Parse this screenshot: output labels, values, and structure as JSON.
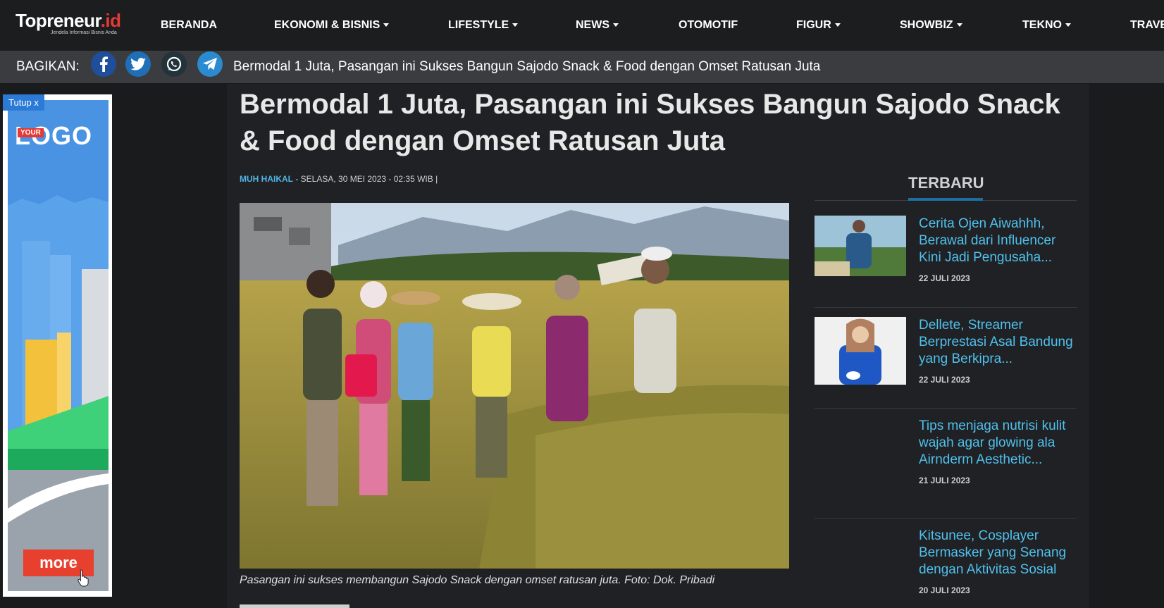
{
  "logo": {
    "name": "Topreneur",
    "suffix": ".id",
    "tagline": "Jendela Informasi Bisnis Anda"
  },
  "nav": [
    {
      "label": "BERANDA",
      "caret": false
    },
    {
      "label": "EKONOMI & BISNIS",
      "caret": true
    },
    {
      "label": "LIFESTYLE",
      "caret": true
    },
    {
      "label": "NEWS",
      "caret": true
    },
    {
      "label": "OTOMOTIF",
      "caret": false
    },
    {
      "label": "FIGUR",
      "caret": true
    },
    {
      "label": "SHOWBIZ",
      "caret": true
    },
    {
      "label": "TEKNO",
      "caret": true
    },
    {
      "label": "TRAVE",
      "caret": false
    }
  ],
  "share": {
    "label": "BAGIKAN:",
    "icons": [
      "facebook-icon",
      "twitter-icon",
      "whatsapp-icon",
      "telegram-icon"
    ],
    "title": "Bermodal 1 Juta, Pasangan ini Sukses Bangun Sajodo Snack & Food dengan Omset Ratusan Juta"
  },
  "ad": {
    "close_label": "Tutup x",
    "logo_badge": "YOUR",
    "logo_text": "LOGO",
    "more_label": "more"
  },
  "article": {
    "title": "Bermodal 1 Juta, Pasangan ini Sukses Bangun Sajodo Snack & Food dengan Omset Ratusan Juta",
    "author": "MUH HAIKAL",
    "meta_rest": " - SELASA, 30 MEI 2023 - 02:35 WIB |",
    "caption": "Pasangan ini sukses membangun Sajodo Snack dengan omset ratusan juta. Foto: Dok. Pribadi"
  },
  "sidebar": {
    "heading": "TERBARU",
    "items": [
      {
        "title": "Cerita Ojen Aiwahhh, Berawal dari Influencer Kini Jadi Pengusaha...",
        "date": "22 JULI 2023",
        "thumb": true
      },
      {
        "title": "Dellete, Streamer Berprestasi Asal Bandung yang Berkipra...",
        "date": "22 JULI 2023",
        "thumb": true
      },
      {
        "title": "Tips menjaga nutrisi kulit wajah agar glowing ala Airnderm Aesthetic...",
        "date": "21 JULI 2023",
        "thumb": false
      },
      {
        "title": "Kitsunee, Cosplayer Bermasker yang Senang dengan Aktivitas Sosial",
        "date": "20 JULI 2023",
        "thumb": false
      }
    ]
  },
  "colors": {
    "accent": "#4fc1ee",
    "topbar": "#1c1d1f",
    "sharebar": "#3a3c40"
  }
}
